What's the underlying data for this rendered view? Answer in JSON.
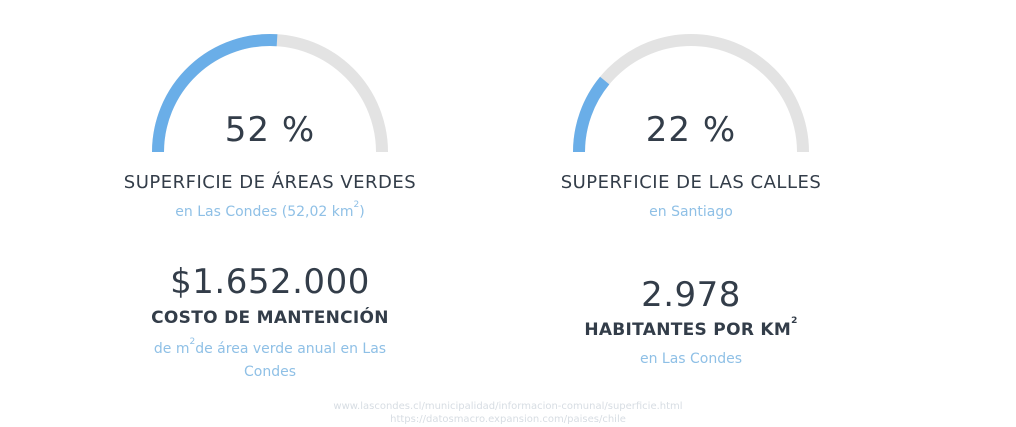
{
  "colors": {
    "accent": "#6aaee8",
    "track": "#e3e3e3",
    "text": "#333d49",
    "subtext": "#8fc0e6"
  },
  "left": {
    "gauge": {
      "value_label": "52 %",
      "fraction": 0.52
    },
    "title": "SUPERFICIE DE ÁREAS VERDES",
    "subtitle_pre": "en Las Condes (52,02 km",
    "subtitle_sup": "2",
    "subtitle_post": ")",
    "big_value": "$1.652.000",
    "caption": "COSTO DE MANTENCIÓN",
    "note_pre": "de m",
    "note_sup": "2",
    "note_line1_post": "de área verde anual en Las",
    "note_line2": "Condes"
  },
  "right": {
    "gauge": {
      "value_label": "22 %",
      "fraction": 0.22
    },
    "title": "SUPERFICIE DE LAS CALLES",
    "subtitle": "en Santiago",
    "big_value": "2.978",
    "caption": "HABITANTES POR KM",
    "caption_sup": "2",
    "note": "en Las Condes"
  },
  "sources": [
    "www.lascondes.cl/municipalidad/informacion-comunal/superficie.html",
    "https://datosmacro.expansion.com/paises/chile"
  ]
}
